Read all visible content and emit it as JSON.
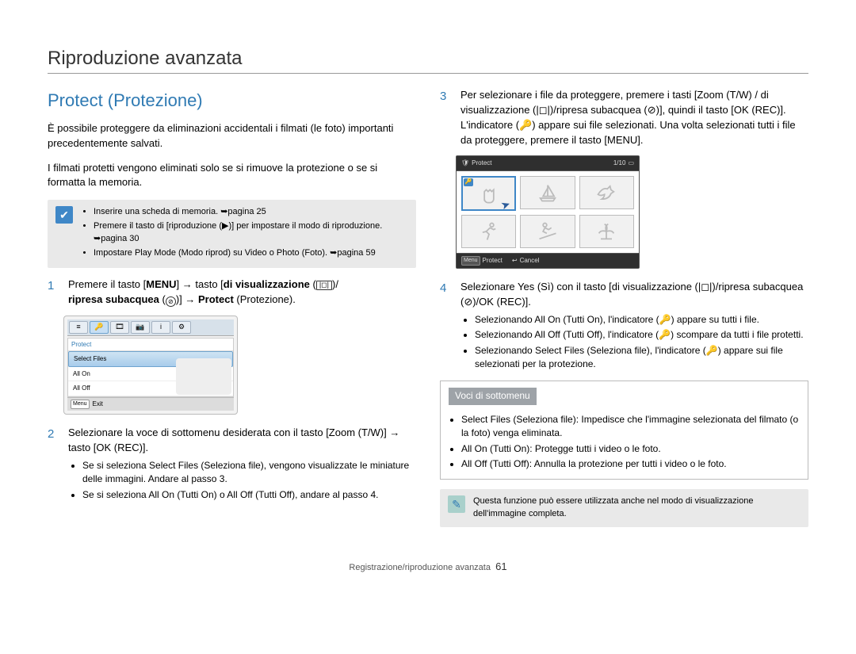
{
  "page_title": "Riproduzione avanzata",
  "section_title": "Protect (Protezione)",
  "intro_p1": "È possibile proteggere da eliminazioni accidentali i filmati (le foto) importanti precedentemente salvati.",
  "intro_p2": "I filmati protetti vengono eliminati solo se si rimuove la protezione o se si formatta la memoria.",
  "pre_note": {
    "items": [
      "Inserire una scheda di memoria. ➥pagina 25",
      "Premere il tasto di [riproduzione (▶)] per impostare il modo di riproduzione. ➥pagina 30",
      "Impostare Play Mode (Modo riprod) su Video o Photo (Foto). ➥pagina 59"
    ]
  },
  "steps": {
    "s1": {
      "num": "1",
      "text_a": "Premere il tasto [",
      "menu": "MENU",
      "text_b": "] → tasto [",
      "disp": "di visualizzazione",
      "text_c": " (",
      "text_d": ")/",
      "sub": "ripresa subacquea",
      "text_e": " (",
      "text_f": ")] → ",
      "protect": "Protect",
      "text_g": " (Protezione)."
    },
    "s2": {
      "num": "2",
      "text": "Selezionare la voce di sottomenu desiderata con il tasto [Zoom (T/W)] → tasto [OK (REC)].",
      "bullets": [
        "Se si seleziona Select Files (Seleziona file), vengono visualizzate le miniature delle immagini. Andare al passo 3.",
        "Se si seleziona All On (Tutti On) o All Off (Tutti Off), andare al passo 4."
      ]
    },
    "s3": {
      "num": "3",
      "text": "Per selezionare i file da proteggere, premere i tasti [Zoom (T/W) / di visualizzazione (|◻|)/ripresa subacquea (⊘)], quindi il tasto [OK (REC)]. L'indicatore (🔑) appare sui file selezionati. Una volta selezionati tutti i file da proteggere, premere il tasto [MENU]."
    },
    "s4": {
      "num": "4",
      "text": "Selezionare Yes (Sì) con il tasto [di visualizzazione (|◻|)/ripresa subacquea (⊘)/OK (REC)].",
      "bullets": [
        "Selezionando All On (Tutti On), l'indicatore (🔑) appare su tutti i file.",
        "Selezionando All Off (Tutti Off), l'indicatore (🔑) scompare da tutti i file protetti.",
        "Selezionando Select Files (Seleziona file), l'indicatore (🔑) appare sui file selezionati per la protezione."
      ]
    }
  },
  "device1": {
    "header": "Protect",
    "items": [
      "Select Files",
      "All On",
      "All Off"
    ],
    "selected_index": 0,
    "exit": "Exit",
    "menu_icon": "Menu"
  },
  "device2": {
    "title": "Protect",
    "counter": "1/10",
    "bottom_protect": "Protect",
    "bottom_cancel": "Cancel"
  },
  "submenu_box": {
    "title": "Voci di sottomenu",
    "items": [
      "Select Files (Seleziona file): Impedisce che l'immagine selezionata del filmato (o la foto) venga eliminata.",
      "All On (Tutti On): Protegge tutti i video o le foto.",
      "All Off (Tutti Off): Annulla la protezione per tutti i video o le foto."
    ]
  },
  "tip_note": "Questa funzione può essere utilizzata anche nel modo di visualizzazione dell'immagine completa.",
  "footer": {
    "text": "Registrazione/riproduzione avanzata",
    "page": "61"
  }
}
